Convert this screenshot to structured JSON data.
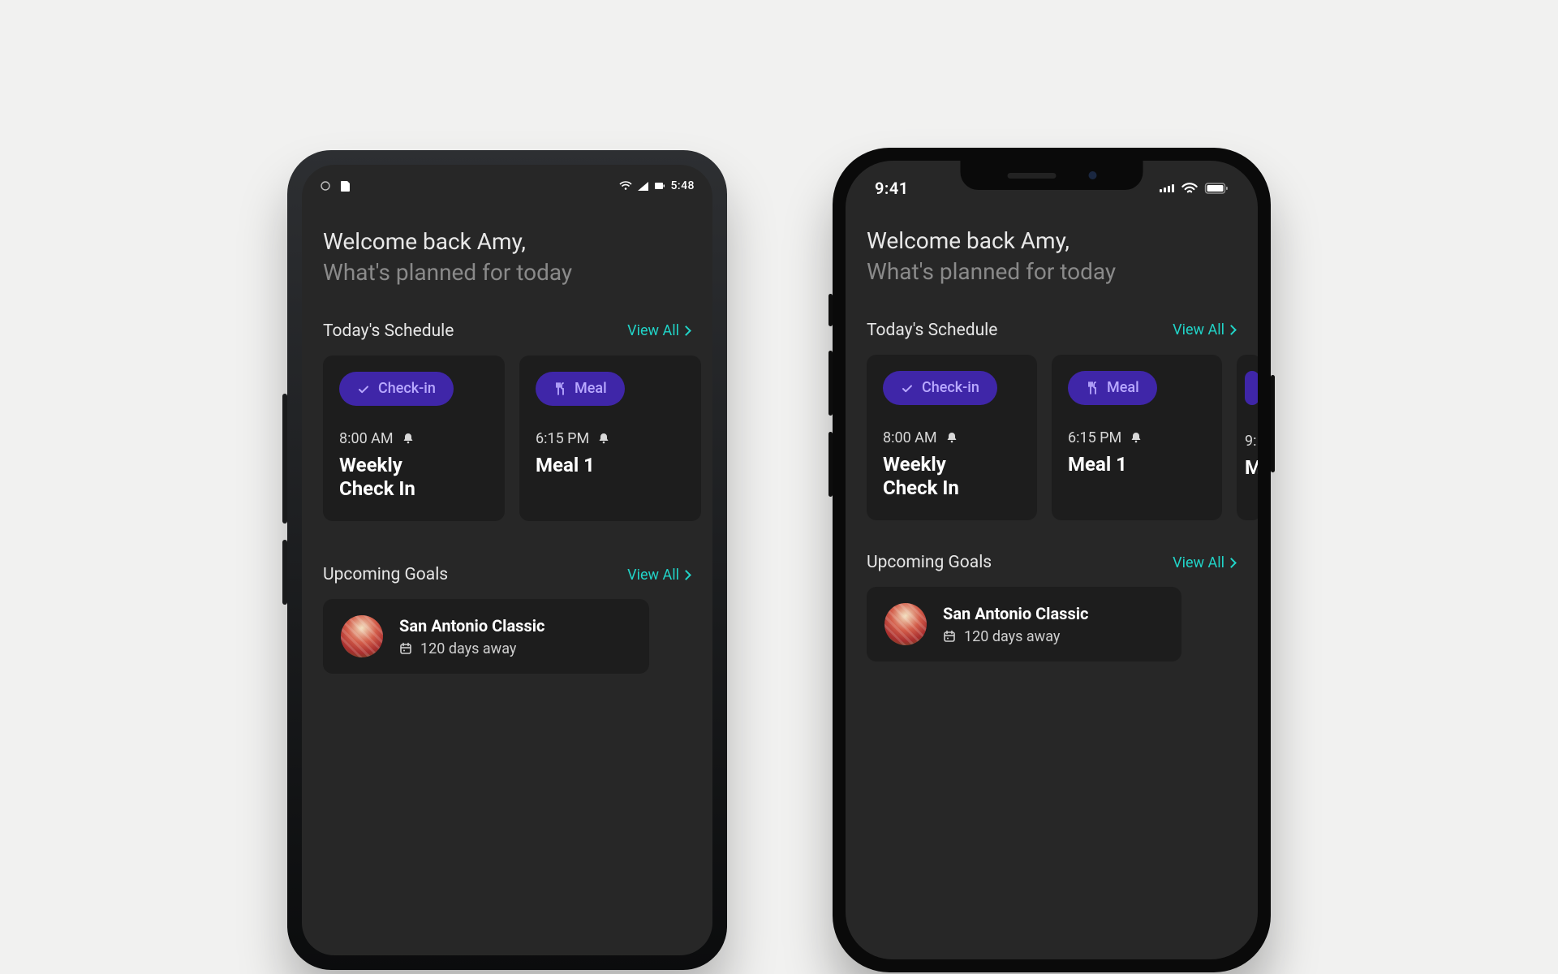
{
  "android": {
    "status_time": "5:48"
  },
  "iphone": {
    "status_time": "9:41"
  },
  "app": {
    "greeting_line1": "Welcome back Amy,",
    "greeting_line2": "What's planned for today",
    "schedule": {
      "heading": "Today's Schedule",
      "view_all": "View All",
      "cards": [
        {
          "pill_icon": "check-icon",
          "pill_label": "Check-in",
          "time": "8:00 AM",
          "title": "Weekly Check In"
        },
        {
          "pill_icon": "utensils-icon",
          "pill_label": "Meal",
          "time": "6:15 PM",
          "title": "Meal 1"
        },
        {
          "pill_icon": "utensils-icon",
          "pill_label": "",
          "time": "9:",
          "title": "M"
        }
      ]
    },
    "goals": {
      "heading": "Upcoming Goals",
      "view_all": "View All",
      "item": {
        "title": "San Antonio Classic",
        "countdown": "120 days away"
      }
    }
  },
  "colors": {
    "accent_teal": "#21d4c8",
    "pill_purple": "#3f26a8",
    "pill_text": "#b9a9ff"
  }
}
